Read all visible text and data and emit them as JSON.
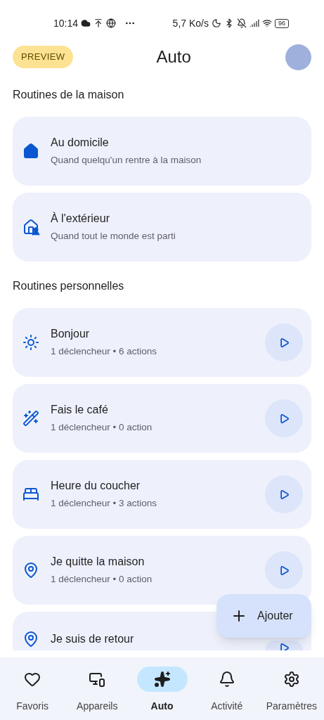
{
  "status_bar": {
    "time": "10:14",
    "speed": "5,7 Ko/s",
    "battery": "96"
  },
  "header": {
    "badge": "PREVIEW",
    "title": "Auto"
  },
  "sections": [
    {
      "title": "Routines de la maison",
      "kind": "home",
      "routines": [
        {
          "title": "Au domicile",
          "subtitle": "Quand quelqu'un rentre à la maison"
        },
        {
          "title": "À l'extérieur",
          "subtitle": "Quand tout le monde est parti"
        }
      ]
    },
    {
      "title": "Routines personnelles",
      "kind": "personal",
      "routines": [
        {
          "title": "Bonjour",
          "subtitle": "1 déclencheur • 6 actions"
        },
        {
          "title": "Fais le café",
          "subtitle": "1 déclencheur • 0 action"
        },
        {
          "title": "Heure du coucher",
          "subtitle": "1 déclencheur • 3 actions"
        },
        {
          "title": "Je quitte la maison",
          "subtitle": "1 déclencheur • 0 action"
        },
        {
          "title": "Je suis de retour",
          "cut_off": true
        }
      ]
    }
  ],
  "fab": {
    "label": "Ajouter"
  },
  "nav": [
    {
      "label": "Favoris",
      "selected": false
    },
    {
      "label": "Appareils",
      "selected": false
    },
    {
      "label": "Auto",
      "selected": true
    },
    {
      "label": "Activité",
      "selected": false
    },
    {
      "label": "Paramètres",
      "selected": false
    }
  ]
}
